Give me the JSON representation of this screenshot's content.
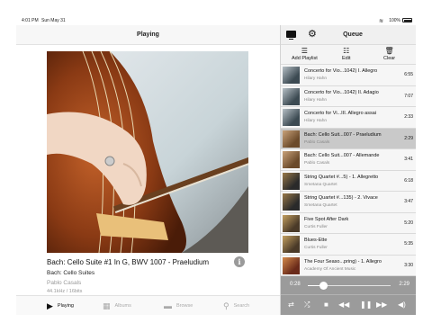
{
  "status_bar": {
    "time": "4:01 PM",
    "date": "Sun May 31",
    "battery": "100%"
  },
  "player": {
    "header_title": "Playing",
    "track_title": "Bach: Cello Suite #1 In G, BWV 1007 - Praeludium",
    "album": "Bach: Cello Suites",
    "artist": "Pablo Casals",
    "format": "44.1kHz / 16bits",
    "info_glyph": "i"
  },
  "tabs": [
    {
      "label": "Playing",
      "icon": "play-icon"
    },
    {
      "label": "Albums",
      "icon": "grid-icon"
    },
    {
      "label": "Browse",
      "icon": "folder-icon"
    },
    {
      "label": "Search",
      "icon": "search-icon"
    }
  ],
  "queue": {
    "title": "Queue",
    "actions": [
      {
        "label": "Add Playlist",
        "icon": "add-playlist-icon"
      },
      {
        "label": "Edit",
        "icon": "edit-list-icon"
      },
      {
        "label": "Clear",
        "icon": "trash-icon"
      }
    ],
    "items": [
      {
        "title": "Concerto for Vio...1042) I. Allegro",
        "artist": "Hilary Hahn",
        "duration": "6:55"
      },
      {
        "title": "Concerto for Vio...1042) II. Adagio",
        "artist": "Hilary Hahn",
        "duration": "7:07"
      },
      {
        "title": "Concerto for Vi...III. Allegro assai",
        "artist": "Hilary Hahn",
        "duration": "2:33"
      },
      {
        "title": "Bach: Cello Suit...007 - Praeludium",
        "artist": "Pablo Casals",
        "duration": "2:29"
      },
      {
        "title": "Bach: Cello Suit...007 - Allemande",
        "artist": "Pablo Casals",
        "duration": "3:41"
      },
      {
        "title": "String Quartet #...5) - 1. Allegretto",
        "artist": "Smetana Quartet",
        "duration": "6:18"
      },
      {
        "title": "String Quartet #...135) - 2. Vivace",
        "artist": "Smetana Quartet",
        "duration": "3:47"
      },
      {
        "title": "Five Spot After Dark",
        "artist": "Curtis Fuller",
        "duration": "5:20"
      },
      {
        "title": "Blues-Ette",
        "artist": "Curtis Fuller",
        "duration": "5:35"
      },
      {
        "title": "The Four Seaso...pring) - 1. Allegro",
        "artist": "Academy Of Ancient Music",
        "duration": "3:30"
      }
    ],
    "current_index": 3
  },
  "playback": {
    "elapsed": "0:28",
    "total": "2:29",
    "progress_fraction": 0.19
  },
  "colors": {
    "panel_gray": "#9b9b9b",
    "current_row": "#c9c9c9"
  }
}
